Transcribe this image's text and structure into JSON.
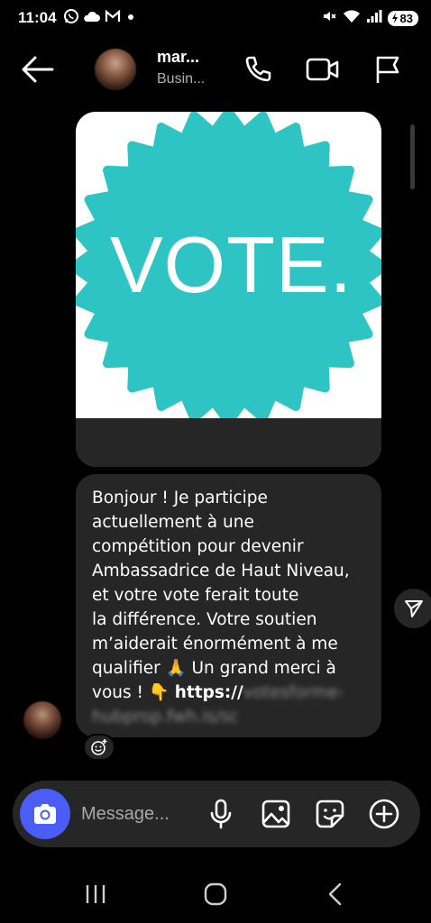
{
  "status_bar": {
    "time": "11:04",
    "battery": "83",
    "notification_icons": [
      "whatsapp-icon",
      "cloud-icon",
      "gmail-icon",
      "dot-icon"
    ],
    "system_icons": [
      "mute-icon",
      "wifi-icon",
      "signal-icon",
      "battery-icon"
    ]
  },
  "header": {
    "contact_name": "mar...",
    "contact_subtitle": "Busin...",
    "icons": [
      "back-arrow-icon",
      "phone-icon",
      "video-camera-icon",
      "flag-icon"
    ]
  },
  "image_message": {
    "image_text": "VOTE.",
    "badge_color": "#2ec4c4",
    "background": "#ffffff"
  },
  "text_message": {
    "body": "Bonjour ! Je participe\nactuellement à une\ncompétition pour devenir\nAmbassadrice de Haut Niveau,\net votre vote ferait toute\nla différence. Votre soutien\nm’aiderait énormément à me\nqualifier 🙏 Un grand merci à\nvous ! 👇 ",
    "link_visible": "https://",
    "link_blurred": "votesforme-hubprop.fwh.is/sc"
  },
  "composer": {
    "placeholder": "Message...",
    "icons": [
      "camera-icon",
      "microphone-icon",
      "gallery-icon",
      "sticker-icon",
      "plus-circle-icon"
    ],
    "camera_color": "#4a5df7"
  },
  "nav": {
    "icons": [
      "recents-icon",
      "home-icon",
      "back-icon"
    ]
  },
  "colors": {
    "background": "#000000",
    "bubble": "#262626",
    "accent": "#4a5df7"
  }
}
